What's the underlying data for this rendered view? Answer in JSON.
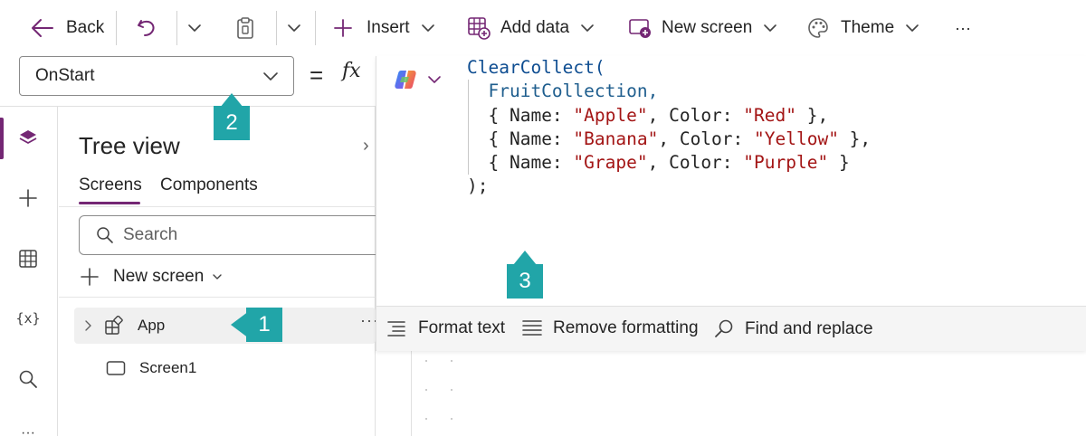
{
  "toolbar": {
    "back_label": "Back",
    "insert_label": "Insert",
    "add_data_label": "Add data",
    "new_screen_label": "New screen",
    "theme_label": "Theme",
    "more_label": "···"
  },
  "formula_bar": {
    "property": "OnStart",
    "equals": "=",
    "fx": "fx"
  },
  "formula_code": {
    "line1_fn": "ClearCollect(",
    "line2_id": "FruitCollection,",
    "rows": [
      {
        "open": "{ ",
        "k1": "Name: ",
        "v1": "\"Apple\"",
        "sep": ", ",
        "k2": "Color: ",
        "v2": "\"Red\"",
        "close": " },"
      },
      {
        "open": "{ ",
        "k1": "Name: ",
        "v1": "\"Banana\"",
        "sep": ", ",
        "k2": "Color: ",
        "v2": "\"Yellow\"",
        "close": " },"
      },
      {
        "open": "{ ",
        "k1": "Name: ",
        "v1": "\"Grape\"",
        "sep": ", ",
        "k2": "Color: ",
        "v2": "\"Purple\"",
        "close": " }"
      }
    ],
    "last_line": ");"
  },
  "editor_toolbar": {
    "format_text": "Format text",
    "remove_formatting": "Remove formatting",
    "find_replace": "Find and replace"
  },
  "tree_view": {
    "title": "Tree view",
    "tabs": [
      "Screens",
      "Components"
    ],
    "search_placeholder": "Search",
    "new_screen_label": "New screen",
    "nodes": [
      "App",
      "Screen1"
    ],
    "more_label": "···"
  },
  "rail": {
    "vars_label": "{x}"
  },
  "callouts": [
    "1",
    "2",
    "3"
  ],
  "colors": {
    "accent": "#742774",
    "callout": "#21a5a8",
    "code_function": "#0e4d91",
    "code_string": "#a31515"
  }
}
